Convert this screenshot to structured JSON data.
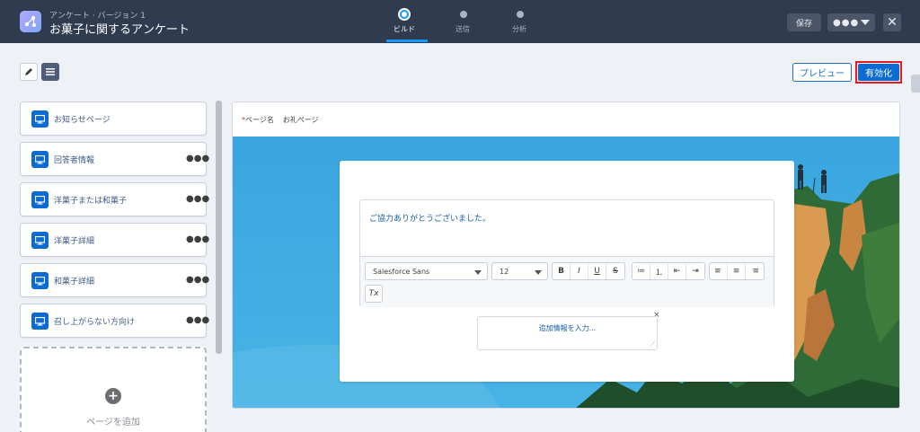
{
  "header": {
    "subtitle": "アンケート · バージョン 1",
    "title": "お菓子に関するアンケート",
    "steps": [
      {
        "label": "ビルド",
        "active": true
      },
      {
        "label": "送信",
        "active": false
      },
      {
        "label": "分析",
        "active": false
      }
    ],
    "save_label": "保存",
    "more_dots": "●●●",
    "close_glyph": "✕"
  },
  "toolbar": {
    "preview_label": "プレビュー",
    "activate_label": "有効化"
  },
  "pages": [
    {
      "label": "お知らせページ",
      "menu": false
    },
    {
      "label": "回答者情報",
      "menu": true
    },
    {
      "label": "洋菓子または和菓子",
      "menu": true
    },
    {
      "label": "洋菓子詳細",
      "menu": true
    },
    {
      "label": "和菓子詳細",
      "menu": true
    },
    {
      "label": "召し上がらない方向け",
      "menu": true
    }
  ],
  "page_menu_glyph": "●●●",
  "add_page": {
    "plus": "+",
    "label": "ページを追加"
  },
  "editor_panel": {
    "required_mark": "*",
    "page_name_label": "ページ名",
    "page_name_value": "お礼ページ",
    "body_text": "ご協力ありがとうございました。",
    "font_value": "Salesforce Sans",
    "size_value": "12",
    "format_buttons": [
      "B",
      "I",
      "U",
      "S"
    ],
    "list_buttons": [
      "≔",
      "⒈",
      "⇤",
      "⇥"
    ],
    "align_buttons": [
      "≡",
      "≡",
      "≡"
    ],
    "clear_format": "Tx",
    "extra_placeholder": "追加情報を入力...",
    "extra_close": "×"
  },
  "colors": {
    "header_bg": "#2f3b4e",
    "brand_blue": "#0b6bd3",
    "highlight_red": "#e81820",
    "sky_blue": "#38a9e0"
  }
}
